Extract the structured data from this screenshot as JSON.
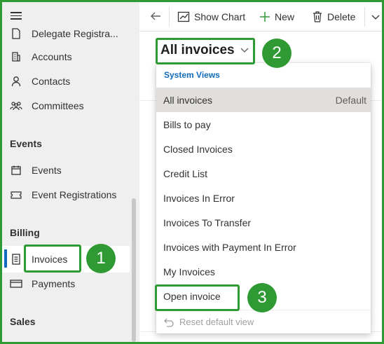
{
  "sidebar": {
    "items_top": [
      {
        "label": "Delegate Registra...",
        "icon": "document-icon"
      },
      {
        "label": "Accounts",
        "icon": "building-icon"
      },
      {
        "label": "Contacts",
        "icon": "person-icon"
      },
      {
        "label": "Committees",
        "icon": "people-group-icon"
      }
    ],
    "sections": {
      "events": "Events",
      "billing": "Billing",
      "sales": "Sales"
    },
    "events_items": [
      {
        "label": "Events",
        "icon": "calendar-icon"
      },
      {
        "label": "Event Registrations",
        "icon": "ticket-icon"
      }
    ],
    "billing_items": [
      {
        "label": "Invoices",
        "icon": "invoice-icon",
        "selected": true
      },
      {
        "label": "Payments",
        "icon": "payment-icon"
      }
    ]
  },
  "toolbar": {
    "show_chart": "Show Chart",
    "new": "New",
    "delete": "Delete"
  },
  "view": {
    "title": "All invoices"
  },
  "dropdown": {
    "header": "System Views",
    "items": [
      {
        "label": "All invoices",
        "tag": "Default"
      },
      {
        "label": "Bills to pay"
      },
      {
        "label": "Closed Invoices"
      },
      {
        "label": "Credit List"
      },
      {
        "label": "Invoices In Error"
      },
      {
        "label": "Invoices To Transfer"
      },
      {
        "label": "Invoices with Payment In Error"
      },
      {
        "label": "My Invoices"
      },
      {
        "label": "Open invoice"
      }
    ],
    "footer": "Reset default view"
  },
  "callouts": {
    "one": "1",
    "two": "2",
    "three": "3"
  },
  "colors": {
    "callout_green": "#2f9a34",
    "accent_blue": "#0f6cbd",
    "sidebar_bg": "#efefef"
  }
}
